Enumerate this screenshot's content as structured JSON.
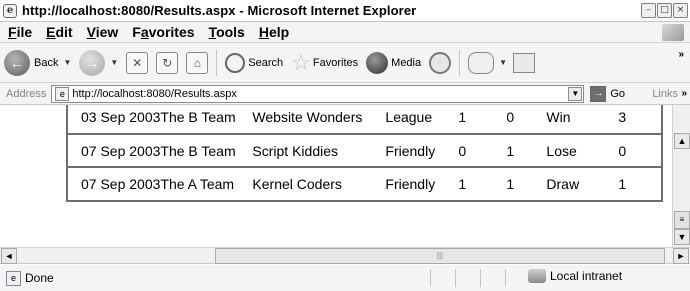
{
  "window": {
    "title": "http://localhost:8080/Results.aspx - Microsoft Internet Explorer"
  },
  "menu": {
    "items": [
      {
        "label": "File",
        "accel": "F",
        "rest": "ile"
      },
      {
        "label": "Edit",
        "accel": "E",
        "rest": "dit"
      },
      {
        "label": "View",
        "accel": "V",
        "rest": "iew"
      },
      {
        "label": "Favorites",
        "pre": "F",
        "accel": "a",
        "rest": "vorites"
      },
      {
        "label": "Tools",
        "accel": "T",
        "rest": "ools"
      },
      {
        "label": "Help",
        "accel": "H",
        "rest": "elp"
      }
    ]
  },
  "toolbar": {
    "back_label": "Back",
    "search_label": "Search",
    "favorites_label": "Favorites",
    "media_label": "Media"
  },
  "address": {
    "label": "Address",
    "url": "http://localhost:8080/Results.aspx",
    "go_label": "Go",
    "links_label": "Links"
  },
  "results": {
    "rows": [
      {
        "date": "03 Sep 2003",
        "team": "The B Team",
        "opponent": "Website Wonders",
        "type": "League",
        "score_for": "1",
        "score_against": "0",
        "result": "Win",
        "points": "3"
      },
      {
        "date": "07 Sep 2003",
        "team": "The B Team",
        "opponent": "Script Kiddies",
        "type": "Friendly",
        "score_for": "0",
        "score_against": "1",
        "result": "Lose",
        "points": "0"
      },
      {
        "date": "07 Sep 2003",
        "team": "The A Team",
        "opponent": "Kernel Coders",
        "type": "Friendly",
        "score_for": "1",
        "score_against": "1",
        "result": "Draw",
        "points": "1"
      }
    ]
  },
  "status": {
    "text": "Done",
    "zone": "Local intranet"
  }
}
